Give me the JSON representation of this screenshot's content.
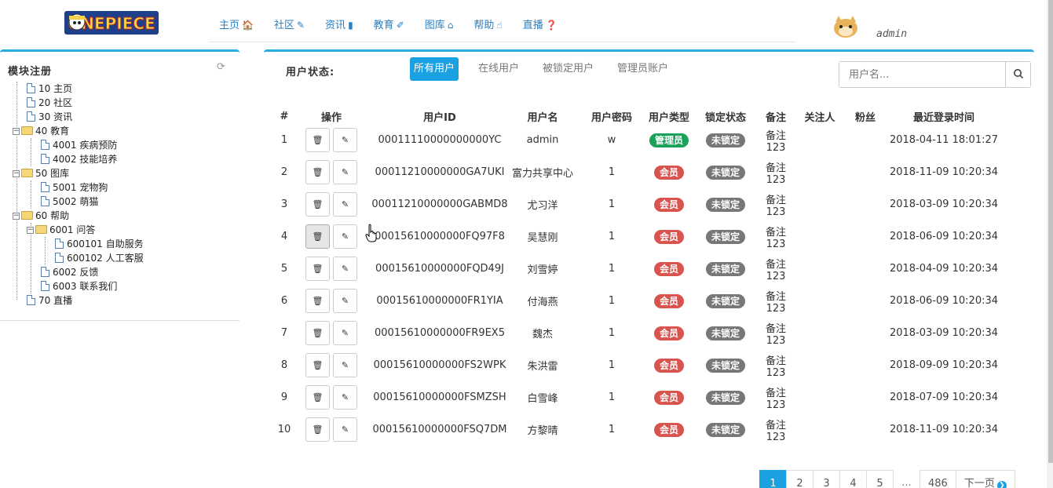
{
  "header": {
    "logo_text": "ONEPIECE",
    "nav": [
      {
        "label": "主页",
        "icon": "🏠"
      },
      {
        "label": "社区",
        "icon": "✎"
      },
      {
        "label": "资讯",
        "icon": "▮"
      },
      {
        "label": "教育",
        "icon": "✐"
      },
      {
        "label": "图库",
        "icon": "⌂"
      },
      {
        "label": "帮助",
        "icon": "☝"
      },
      {
        "label": "直播",
        "icon": "❓"
      }
    ],
    "username": "admin"
  },
  "sidebar": {
    "title": "模块注册",
    "tree": [
      {
        "text": "10 主页"
      },
      {
        "text": "20 社区"
      },
      {
        "text": "30 资讯"
      },
      {
        "text": "40 教育"
      },
      {
        "text": "4001 疾病预防"
      },
      {
        "text": "4002 技能培养"
      },
      {
        "text": "50 图库"
      },
      {
        "text": "5001 宠物狗"
      },
      {
        "text": "5002 萌猫"
      },
      {
        "text": "60 帮助"
      },
      {
        "text": "6001 问答"
      },
      {
        "text": "600101 自助服务"
      },
      {
        "text": "600102 人工客服"
      },
      {
        "text": "6002 反馈"
      },
      {
        "text": "6003 联系我们"
      },
      {
        "text": "70 直播"
      }
    ]
  },
  "main": {
    "status_label": "用户状态:",
    "filters": [
      "所有用户",
      "在线用户",
      "被锁定用户",
      "管理员账户"
    ],
    "search_placeholder": "用户名...",
    "columns": [
      "#",
      "操作",
      "用户ID",
      "用户名",
      "用户密码",
      "用户类型",
      "锁定状态",
      "备注",
      "关注人",
      "粉丝",
      "最近登录时间"
    ],
    "rows": [
      {
        "n": "1",
        "id": "00011110000000000YC",
        "name": "admin",
        "pwd": "w",
        "type": "管理员",
        "lock": "未锁定",
        "note": "备注123",
        "follow": "",
        "fans": "",
        "time": "2018-04-11 18:01:27"
      },
      {
        "n": "2",
        "id": "00011210000000GA7UKI",
        "name": "富力共享中心",
        "pwd": "1",
        "type": "会员",
        "lock": "未锁定",
        "note": "备注123",
        "follow": "",
        "fans": "",
        "time": "2018-11-09 10:20:34"
      },
      {
        "n": "3",
        "id": "00011210000000GABMD8",
        "name": "尤习洋",
        "pwd": "1",
        "type": "会员",
        "lock": "未锁定",
        "note": "备注123",
        "follow": "",
        "fans": "",
        "time": "2018-03-09 10:20:34"
      },
      {
        "n": "4",
        "id": "00015610000000FQ97F8",
        "name": "吴慧刚",
        "pwd": "1",
        "type": "会员",
        "lock": "未锁定",
        "note": "备注123",
        "follow": "",
        "fans": "",
        "time": "2018-06-09 10:20:34"
      },
      {
        "n": "5",
        "id": "00015610000000FQD49J",
        "name": "刘雪婷",
        "pwd": "1",
        "type": "会员",
        "lock": "未锁定",
        "note": "备注123",
        "follow": "",
        "fans": "",
        "time": "2018-04-09 10:20:34"
      },
      {
        "n": "6",
        "id": "00015610000000FR1YIA",
        "name": "付海燕",
        "pwd": "1",
        "type": "会员",
        "lock": "未锁定",
        "note": "备注123",
        "follow": "",
        "fans": "",
        "time": "2018-06-09 10:20:34"
      },
      {
        "n": "7",
        "id": "00015610000000FR9EX5",
        "name": "魏杰",
        "pwd": "1",
        "type": "会员",
        "lock": "未锁定",
        "note": "备注123",
        "follow": "",
        "fans": "",
        "time": "2018-03-09 10:20:34"
      },
      {
        "n": "8",
        "id": "00015610000000FS2WPK",
        "name": "朱洪雷",
        "pwd": "1",
        "type": "会员",
        "lock": "未锁定",
        "note": "备注123",
        "follow": "",
        "fans": "",
        "time": "2018-09-09 10:20:34"
      },
      {
        "n": "9",
        "id": "00015610000000FSMZSH",
        "name": "白雪峰",
        "pwd": "1",
        "type": "会员",
        "lock": "未锁定",
        "note": "备注123",
        "follow": "",
        "fans": "",
        "time": "2018-07-09 10:20:34"
      },
      {
        "n": "10",
        "id": "00015610000000FSQ7DM",
        "name": "方黎晴",
        "pwd": "1",
        "type": "会员",
        "lock": "未锁定",
        "note": "备注123",
        "follow": "",
        "fans": "",
        "time": "2018-11-09 10:20:34"
      }
    ],
    "pagination": [
      "1",
      "2",
      "3",
      "4",
      "5",
      "...",
      "486",
      "下一页"
    ]
  },
  "colors": {
    "accent": "#1ba1e2",
    "admin_badge": "#1aa15a",
    "member_badge": "#d9534f",
    "lock_badge": "#777777"
  },
  "icons": {
    "row_delete": "trash-icon",
    "row_edit": "pencil-icon",
    "search": "search-icon",
    "refresh": "refresh-icon",
    "next": "chevron-right-circle-icon"
  }
}
